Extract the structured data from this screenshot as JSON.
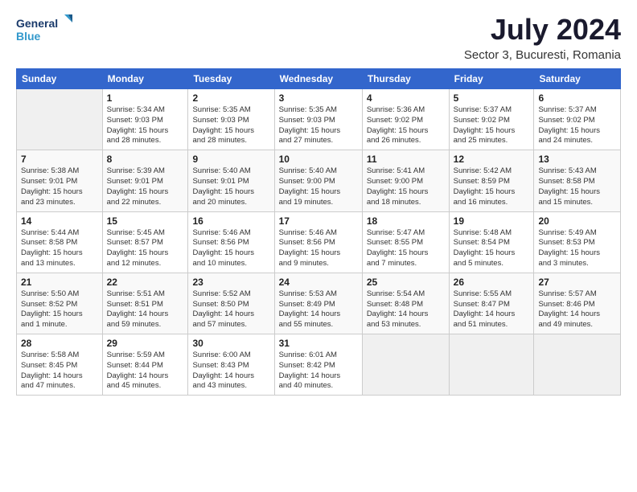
{
  "logo": {
    "line1": "General",
    "line2": "Blue"
  },
  "title": "July 2024",
  "subtitle": "Sector 3, Bucuresti, Romania",
  "days_of_week": [
    "Sunday",
    "Monday",
    "Tuesday",
    "Wednesday",
    "Thursday",
    "Friday",
    "Saturday"
  ],
  "weeks": [
    [
      {
        "day": "",
        "info": ""
      },
      {
        "day": "1",
        "info": "Sunrise: 5:34 AM\nSunset: 9:03 PM\nDaylight: 15 hours\nand 28 minutes."
      },
      {
        "day": "2",
        "info": "Sunrise: 5:35 AM\nSunset: 9:03 PM\nDaylight: 15 hours\nand 28 minutes."
      },
      {
        "day": "3",
        "info": "Sunrise: 5:35 AM\nSunset: 9:03 PM\nDaylight: 15 hours\nand 27 minutes."
      },
      {
        "day": "4",
        "info": "Sunrise: 5:36 AM\nSunset: 9:02 PM\nDaylight: 15 hours\nand 26 minutes."
      },
      {
        "day": "5",
        "info": "Sunrise: 5:37 AM\nSunset: 9:02 PM\nDaylight: 15 hours\nand 25 minutes."
      },
      {
        "day": "6",
        "info": "Sunrise: 5:37 AM\nSunset: 9:02 PM\nDaylight: 15 hours\nand 24 minutes."
      }
    ],
    [
      {
        "day": "7",
        "info": "Sunrise: 5:38 AM\nSunset: 9:01 PM\nDaylight: 15 hours\nand 23 minutes."
      },
      {
        "day": "8",
        "info": "Sunrise: 5:39 AM\nSunset: 9:01 PM\nDaylight: 15 hours\nand 22 minutes."
      },
      {
        "day": "9",
        "info": "Sunrise: 5:40 AM\nSunset: 9:01 PM\nDaylight: 15 hours\nand 20 minutes."
      },
      {
        "day": "10",
        "info": "Sunrise: 5:40 AM\nSunset: 9:00 PM\nDaylight: 15 hours\nand 19 minutes."
      },
      {
        "day": "11",
        "info": "Sunrise: 5:41 AM\nSunset: 9:00 PM\nDaylight: 15 hours\nand 18 minutes."
      },
      {
        "day": "12",
        "info": "Sunrise: 5:42 AM\nSunset: 8:59 PM\nDaylight: 15 hours\nand 16 minutes."
      },
      {
        "day": "13",
        "info": "Sunrise: 5:43 AM\nSunset: 8:58 PM\nDaylight: 15 hours\nand 15 minutes."
      }
    ],
    [
      {
        "day": "14",
        "info": "Sunrise: 5:44 AM\nSunset: 8:58 PM\nDaylight: 15 hours\nand 13 minutes."
      },
      {
        "day": "15",
        "info": "Sunrise: 5:45 AM\nSunset: 8:57 PM\nDaylight: 15 hours\nand 12 minutes."
      },
      {
        "day": "16",
        "info": "Sunrise: 5:46 AM\nSunset: 8:56 PM\nDaylight: 15 hours\nand 10 minutes."
      },
      {
        "day": "17",
        "info": "Sunrise: 5:46 AM\nSunset: 8:56 PM\nDaylight: 15 hours\nand 9 minutes."
      },
      {
        "day": "18",
        "info": "Sunrise: 5:47 AM\nSunset: 8:55 PM\nDaylight: 15 hours\nand 7 minutes."
      },
      {
        "day": "19",
        "info": "Sunrise: 5:48 AM\nSunset: 8:54 PM\nDaylight: 15 hours\nand 5 minutes."
      },
      {
        "day": "20",
        "info": "Sunrise: 5:49 AM\nSunset: 8:53 PM\nDaylight: 15 hours\nand 3 minutes."
      }
    ],
    [
      {
        "day": "21",
        "info": "Sunrise: 5:50 AM\nSunset: 8:52 PM\nDaylight: 15 hours\nand 1 minute."
      },
      {
        "day": "22",
        "info": "Sunrise: 5:51 AM\nSunset: 8:51 PM\nDaylight: 14 hours\nand 59 minutes."
      },
      {
        "day": "23",
        "info": "Sunrise: 5:52 AM\nSunset: 8:50 PM\nDaylight: 14 hours\nand 57 minutes."
      },
      {
        "day": "24",
        "info": "Sunrise: 5:53 AM\nSunset: 8:49 PM\nDaylight: 14 hours\nand 55 minutes."
      },
      {
        "day": "25",
        "info": "Sunrise: 5:54 AM\nSunset: 8:48 PM\nDaylight: 14 hours\nand 53 minutes."
      },
      {
        "day": "26",
        "info": "Sunrise: 5:55 AM\nSunset: 8:47 PM\nDaylight: 14 hours\nand 51 minutes."
      },
      {
        "day": "27",
        "info": "Sunrise: 5:57 AM\nSunset: 8:46 PM\nDaylight: 14 hours\nand 49 minutes."
      }
    ],
    [
      {
        "day": "28",
        "info": "Sunrise: 5:58 AM\nSunset: 8:45 PM\nDaylight: 14 hours\nand 47 minutes."
      },
      {
        "day": "29",
        "info": "Sunrise: 5:59 AM\nSunset: 8:44 PM\nDaylight: 14 hours\nand 45 minutes."
      },
      {
        "day": "30",
        "info": "Sunrise: 6:00 AM\nSunset: 8:43 PM\nDaylight: 14 hours\nand 43 minutes."
      },
      {
        "day": "31",
        "info": "Sunrise: 6:01 AM\nSunset: 8:42 PM\nDaylight: 14 hours\nand 40 minutes."
      },
      {
        "day": "",
        "info": ""
      },
      {
        "day": "",
        "info": ""
      },
      {
        "day": "",
        "info": ""
      }
    ]
  ]
}
